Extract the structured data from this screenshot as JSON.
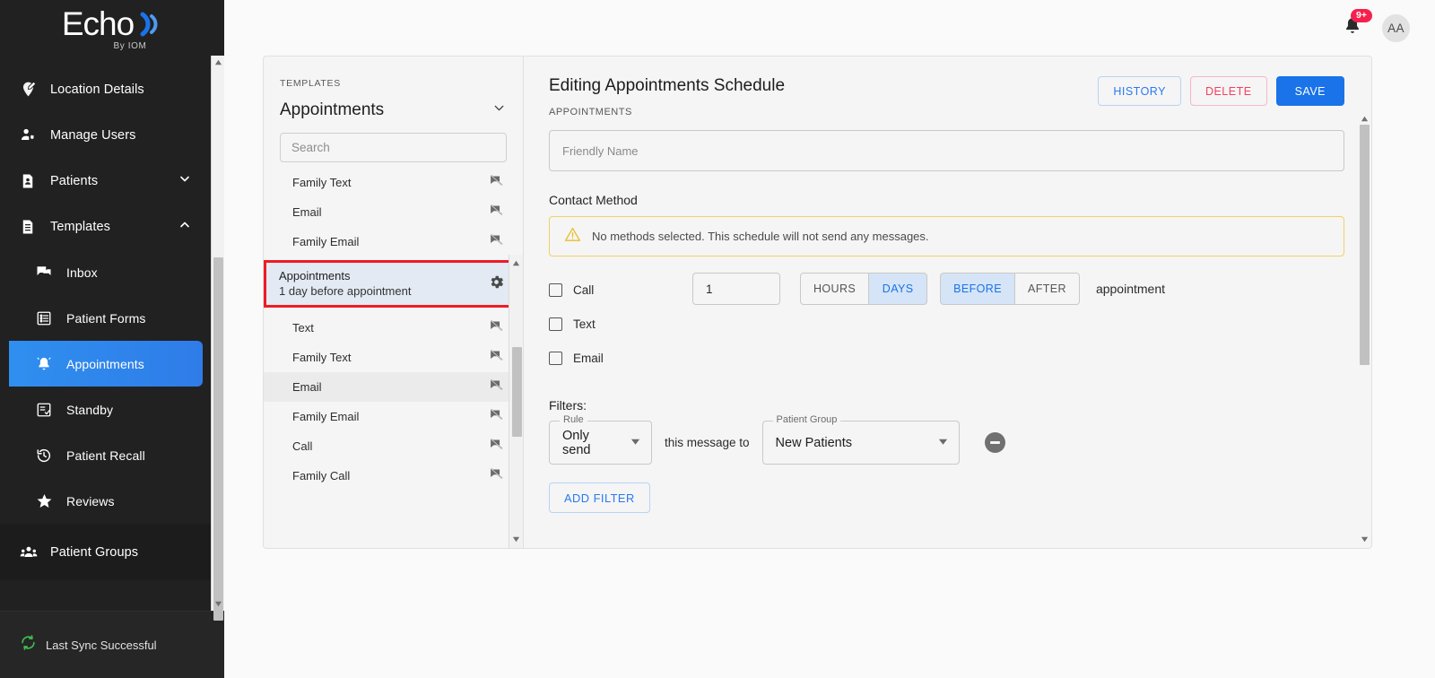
{
  "brand": {
    "logo_text": "Echo",
    "logo_sub": "By IOM",
    "accent_blue": "#1a73e8",
    "highlight_red": "#ee1c25"
  },
  "sidebar": {
    "items": [
      {
        "label": "Location Details",
        "icon": "location-edit-icon",
        "chevron": "",
        "active": false
      },
      {
        "label": "Manage Users",
        "icon": "manage-users-icon",
        "chevron": "",
        "active": false
      },
      {
        "label": "Patients",
        "icon": "patients-icon",
        "chevron": "chevron-down-icon",
        "active": false
      },
      {
        "label": "Templates",
        "icon": "templates-icon",
        "chevron": "chevron-up-icon",
        "active": false
      }
    ],
    "sub_items": [
      {
        "label": "Inbox",
        "icon": "inbox-chat-icon",
        "active": false
      },
      {
        "label": "Patient Forms",
        "icon": "patient-forms-icon",
        "active": false
      },
      {
        "label": "Appointments",
        "icon": "bell-icon",
        "active": true
      },
      {
        "label": "Standby",
        "icon": "standby-checklist-icon",
        "active": false
      },
      {
        "label": "Patient Recall",
        "icon": "history-clock-icon",
        "active": false
      },
      {
        "label": "Reviews",
        "icon": "star-icon",
        "active": false
      }
    ],
    "group_items": [
      {
        "label": "Patient Groups",
        "icon": "patient-groups-icon",
        "active": false
      }
    ],
    "sync_status": "Last Sync Successful"
  },
  "topbar": {
    "notification_badge": "9+",
    "bell_icon": "bell-icon",
    "avatar_initials": "AA"
  },
  "templates_panel": {
    "kicker": "TEMPLATES",
    "title": "Appointments",
    "collapse_icon": "chevron-down-icon",
    "search": {
      "value": "",
      "placeholder": "Search"
    },
    "rows_above": [
      {
        "label": "Family Text",
        "icon": "announcement-off-icon",
        "hovered": false
      },
      {
        "label": "Email",
        "icon": "announcement-off-icon",
        "hovered": false
      },
      {
        "label": "Family Email",
        "icon": "announcement-off-icon",
        "hovered": false
      }
    ],
    "selected": {
      "title": "Appointments",
      "subtitle": "1 day before appointment",
      "icon": "gear-icon"
    },
    "rows_below": [
      {
        "label": "Text",
        "icon": "announcement-off-icon",
        "hovered": false
      },
      {
        "label": "Family Text",
        "icon": "announcement-off-icon",
        "hovered": false
      },
      {
        "label": "Email",
        "icon": "announcement-off-icon",
        "hovered": true
      },
      {
        "label": "Family Email",
        "icon": "announcement-off-icon",
        "hovered": false
      },
      {
        "label": "Call",
        "icon": "announcement-off-icon",
        "hovered": false
      },
      {
        "label": "Family Call",
        "icon": "announcement-off-icon",
        "hovered": false
      }
    ]
  },
  "editor": {
    "title": "Editing Appointments Schedule",
    "kicker": "APPOINTMENTS",
    "buttons": {
      "history": "HISTORY",
      "delete": "DELETE",
      "save": "SAVE"
    },
    "friendly_name": {
      "value": "",
      "placeholder": "Friendly Name"
    },
    "contact_method_label": "Contact Method",
    "warning": {
      "icon": "warning-triangle-icon",
      "text": "No methods selected. This schedule will not send any messages."
    },
    "methods": [
      {
        "label": "Call",
        "checked": false
      },
      {
        "label": "Text",
        "checked": false
      },
      {
        "label": "Email",
        "checked": false
      }
    ],
    "timing": {
      "amount": "1",
      "units": [
        {
          "label": "HOURS",
          "selected": false
        },
        {
          "label": "DAYS",
          "selected": true
        }
      ],
      "relations": [
        {
          "label": "BEFORE",
          "selected": true
        },
        {
          "label": "AFTER",
          "selected": false
        }
      ],
      "suffix": "appointment"
    },
    "filters": {
      "label": "Filters:",
      "rule": {
        "legend": "Rule",
        "value": "Only send"
      },
      "middle_text": "this message to",
      "group": {
        "legend": "Patient Group",
        "value": "New Patients"
      },
      "remove_icon": "minus-circle-icon",
      "add_button": "ADD FILTER"
    }
  }
}
